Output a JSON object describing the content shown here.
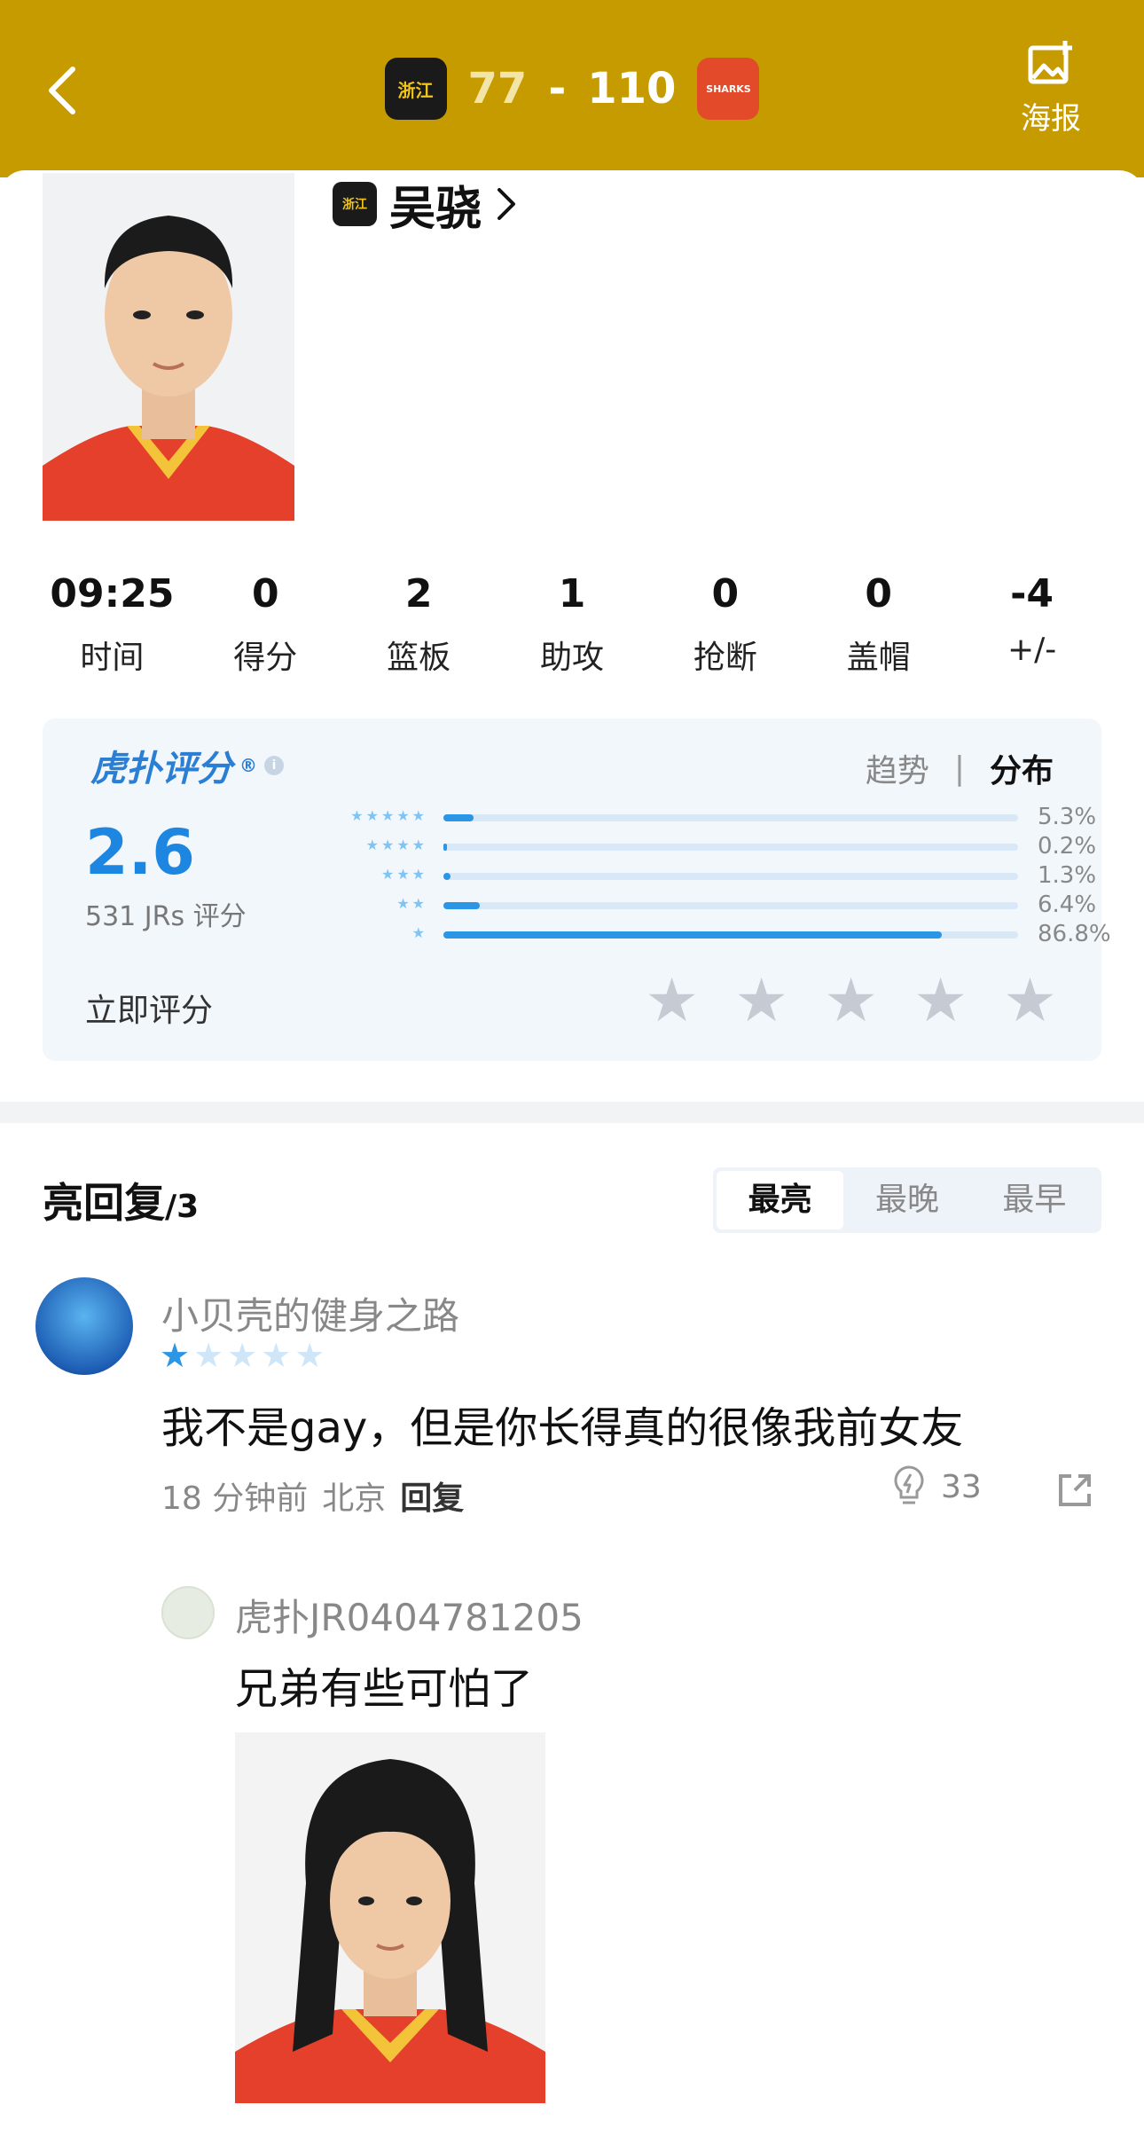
{
  "header": {
    "home_score": "77",
    "separator": "-",
    "away_score": "110",
    "home_team_logo_text": "浙江",
    "away_team_logo_text": "SHARKS",
    "poster_label": "海报"
  },
  "player": {
    "name": "吴骁",
    "team_logo_text": "浙江"
  },
  "stats": [
    {
      "value": "09:25",
      "label": "时间"
    },
    {
      "value": "0",
      "label": "得分"
    },
    {
      "value": "2",
      "label": "篮板"
    },
    {
      "value": "1",
      "label": "助攻"
    },
    {
      "value": "0",
      "label": "抢断"
    },
    {
      "value": "0",
      "label": "盖帽"
    },
    {
      "value": "-4",
      "label": "+/-"
    }
  ],
  "rating": {
    "brand": "虎扑评分",
    "registered_mark": "®",
    "tab_trend": "趋势",
    "tab_separator": "|",
    "tab_distribution": "分布",
    "score": "2.6",
    "count_text": "531 JRs 评分",
    "distribution": [
      {
        "stars": "★★★★★",
        "percent": "5.3%",
        "fraction": 0.053
      },
      {
        "stars": "★★★★",
        "percent": "0.2%",
        "fraction": 0.002
      },
      {
        "stars": "★★★",
        "percent": "1.3%",
        "fraction": 0.013
      },
      {
        "stars": "★★",
        "percent": "6.4%",
        "fraction": 0.064
      },
      {
        "stars": "★",
        "percent": "86.8%",
        "fraction": 0.868
      }
    ],
    "rate_now": "立即评分",
    "accent_color": "#2b95e6"
  },
  "replies": {
    "title": "亮回复",
    "count": "/3",
    "sort_tabs": [
      "最亮",
      "最晚",
      "最早"
    ],
    "active_sort": "最亮",
    "items": [
      {
        "user": "小贝壳的健身之路",
        "stars_on": "★",
        "stars_off": "★★★★",
        "text": "我不是gay，但是你长得真的很像我前女友",
        "time": "18 分钟前",
        "location": "北京",
        "reply_label": "回复",
        "likes": "33"
      },
      {
        "user": "虎扑JR0404781205",
        "text": "兄弟有些可怕了"
      }
    ]
  },
  "colors": {
    "header_bg": "#C69B00",
    "rating_bg": "#f2f7fc",
    "score_blue": "#1d86e0"
  },
  "icons": [
    "back-arrow-icon",
    "image-poster-icon",
    "chevron-right-icon",
    "info-icon",
    "star-icon",
    "lightbulb-icon",
    "share-icon"
  ]
}
